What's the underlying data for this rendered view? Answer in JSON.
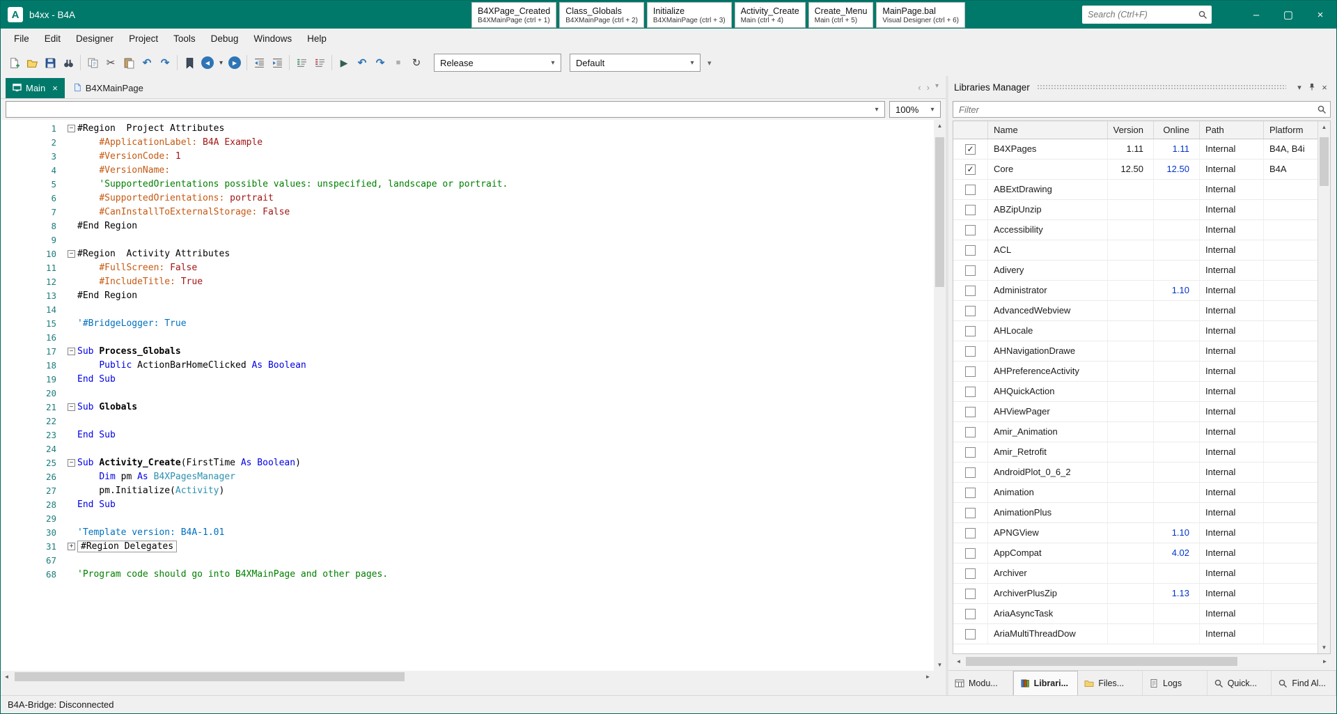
{
  "icons": {
    "minimize": "–",
    "maximize": "▢",
    "close": "×",
    "chevron_down": "▾",
    "tab_scroll_left": "‹",
    "tab_scroll_right": "›",
    "check": "✓",
    "fold_collapsed": "+",
    "fold_expanded": "−",
    "scroll_up": "▲",
    "scroll_down": "▼",
    "scroll_left": "◄",
    "scroll_right": "►",
    "cut": "✂",
    "undo": "↶",
    "redo": "↷",
    "back": "◀",
    "forward": "▶",
    "run": "▶",
    "step_into": "↶",
    "step_over": "↷",
    "stop": "■",
    "rebuild": "↻",
    "overflow": "▾"
  },
  "titlebar": {
    "logo_letter": "A",
    "app_title": "b4xx - B4A",
    "quick_tabs": [
      {
        "title": "B4XPage_Created",
        "subtitle": "B4XMainPage  (ctrl + 1)"
      },
      {
        "title": "Class_Globals",
        "subtitle": "B4XMainPage  (ctrl + 2)"
      },
      {
        "title": "Initialize",
        "subtitle": "B4XMainPage  (ctrl + 3)"
      },
      {
        "title": "Activity_Create",
        "subtitle": "Main  (ctrl + 4)"
      },
      {
        "title": "Create_Menu",
        "subtitle": "Main  (ctrl + 5)"
      },
      {
        "title": "MainPage.bal",
        "subtitle": "Visual Designer  (ctrl + 6)"
      }
    ],
    "search_placeholder": "Search (Ctrl+F)"
  },
  "menubar": {
    "items": [
      "File",
      "Edit",
      "Designer",
      "Project",
      "Tools",
      "Debug",
      "Windows",
      "Help"
    ]
  },
  "toolbar": {
    "build_config": "Release",
    "conditional_symbols": "Default"
  },
  "editor": {
    "tabs": [
      {
        "label": "Main",
        "active": true,
        "closable": true
      },
      {
        "label": "B4XMainPage",
        "active": false,
        "closable": false
      }
    ],
    "sub_navigator_value": "",
    "zoom": "100%",
    "lines": [
      {
        "n": "1",
        "fold": "-",
        "segs": [
          [
            "#Region  Project Attributes",
            "pl"
          ]
        ]
      },
      {
        "n": "2",
        "segs": [
          [
            "    ",
            "pl"
          ],
          [
            "#ApplicationLabel:",
            "at"
          ],
          [
            " ",
            "pl"
          ],
          [
            "B4A Example",
            "vl"
          ]
        ]
      },
      {
        "n": "3",
        "segs": [
          [
            "    ",
            "pl"
          ],
          [
            "#VersionCode:",
            "at"
          ],
          [
            " ",
            "pl"
          ],
          [
            "1",
            "vl"
          ]
        ]
      },
      {
        "n": "4",
        "segs": [
          [
            "    ",
            "pl"
          ],
          [
            "#VersionName:",
            "at"
          ]
        ]
      },
      {
        "n": "5",
        "segs": [
          [
            "    ",
            "pl"
          ],
          [
            "'SupportedOrientations possible values: unspecified, landscape or portrait.",
            "cm"
          ]
        ]
      },
      {
        "n": "6",
        "segs": [
          [
            "    ",
            "pl"
          ],
          [
            "#SupportedOrientations:",
            "at"
          ],
          [
            " ",
            "pl"
          ],
          [
            "portrait",
            "vl"
          ]
        ]
      },
      {
        "n": "7",
        "segs": [
          [
            "    ",
            "pl"
          ],
          [
            "#CanInstallToExternalStorage:",
            "at"
          ],
          [
            " ",
            "pl"
          ],
          [
            "False",
            "vl"
          ]
        ]
      },
      {
        "n": "8",
        "segs": [
          [
            "#End Region",
            "pl"
          ]
        ]
      },
      {
        "n": "9",
        "segs": []
      },
      {
        "n": "10",
        "fold": "-",
        "segs": [
          [
            "#Region  Activity Attributes",
            "pl"
          ]
        ]
      },
      {
        "n": "11",
        "segs": [
          [
            "    ",
            "pl"
          ],
          [
            "#FullScreen:",
            "at"
          ],
          [
            " ",
            "pl"
          ],
          [
            "False",
            "vl"
          ]
        ]
      },
      {
        "n": "12",
        "segs": [
          [
            "    ",
            "pl"
          ],
          [
            "#IncludeTitle:",
            "at"
          ],
          [
            " ",
            "pl"
          ],
          [
            "True",
            "vl"
          ]
        ]
      },
      {
        "n": "13",
        "segs": [
          [
            "#End Region",
            "pl"
          ]
        ]
      },
      {
        "n": "14",
        "segs": []
      },
      {
        "n": "15",
        "segs": [
          [
            "'#BridgeLogger: True",
            "dr"
          ]
        ]
      },
      {
        "n": "16",
        "segs": []
      },
      {
        "n": "17",
        "fold": "-",
        "segs": [
          [
            "Sub ",
            "kw"
          ],
          [
            "Process_Globals",
            "sb"
          ]
        ]
      },
      {
        "n": "18",
        "segs": [
          [
            "    ",
            "pl"
          ],
          [
            "Public ",
            "kw"
          ],
          [
            "ActionBarHomeClicked ",
            "pl"
          ],
          [
            "As ",
            "kw"
          ],
          [
            "Boolean",
            "kw"
          ]
        ]
      },
      {
        "n": "19",
        "segs": [
          [
            "End Sub",
            "kw"
          ]
        ]
      },
      {
        "n": "20",
        "segs": []
      },
      {
        "n": "21",
        "fold": "-",
        "segs": [
          [
            "Sub ",
            "kw"
          ],
          [
            "Globals",
            "sb"
          ]
        ]
      },
      {
        "n": "22",
        "segs": []
      },
      {
        "n": "23",
        "segs": [
          [
            "End Sub",
            "kw"
          ]
        ]
      },
      {
        "n": "24",
        "segs": []
      },
      {
        "n": "25",
        "fold": "-",
        "segs": [
          [
            "Sub ",
            "kw"
          ],
          [
            "Activity_Create",
            "sb"
          ],
          [
            "(FirstTime ",
            "pl"
          ],
          [
            "As ",
            "kw"
          ],
          [
            "Boolean",
            "kw"
          ],
          [
            ")",
            "pl"
          ]
        ]
      },
      {
        "n": "26",
        "segs": [
          [
            "    ",
            "pl"
          ],
          [
            "Dim ",
            "kw"
          ],
          [
            "pm ",
            "pl"
          ],
          [
            "As ",
            "kw"
          ],
          [
            "B4XPagesManager",
            "ty"
          ]
        ]
      },
      {
        "n": "27",
        "segs": [
          [
            "    pm.Initialize(",
            "pl"
          ],
          [
            "Activity",
            "ty"
          ],
          [
            ")",
            "pl"
          ]
        ]
      },
      {
        "n": "28",
        "segs": [
          [
            "End Sub",
            "kw"
          ]
        ]
      },
      {
        "n": "29",
        "segs": []
      },
      {
        "n": "30",
        "segs": [
          [
            "'Template version: B4A-1.01",
            "dr"
          ]
        ]
      },
      {
        "n": "31",
        "fold": "+",
        "collapsed": true,
        "segs": [
          [
            "#Region Delegates",
            "pl"
          ]
        ]
      },
      {
        "n": "67",
        "segs": []
      },
      {
        "n": "68",
        "segs": [
          [
            "'Program code should go into B4XMainPage and other pages.",
            "cm"
          ]
        ]
      }
    ]
  },
  "libraries": {
    "title": "Libraries Manager",
    "filter_placeholder": "Filter",
    "columns": [
      "Name",
      "Version",
      "Online",
      "Path",
      "Platform"
    ],
    "rows": [
      {
        "checked": true,
        "name": "B4XPages",
        "version": "1.11",
        "online": "1.11",
        "path": "Internal",
        "platform": "B4A, B4i"
      },
      {
        "checked": true,
        "name": "Core",
        "version": "12.50",
        "online": "12.50",
        "path": "Internal",
        "platform": "B4A"
      },
      {
        "checked": false,
        "name": "ABExtDrawing",
        "version": "",
        "online": "",
        "path": "Internal",
        "platform": ""
      },
      {
        "checked": false,
        "name": "ABZipUnzip",
        "version": "",
        "online": "",
        "path": "Internal",
        "platform": ""
      },
      {
        "checked": false,
        "name": "Accessibility",
        "version": "",
        "online": "",
        "path": "Internal",
        "platform": ""
      },
      {
        "checked": false,
        "name": "ACL",
        "version": "",
        "online": "",
        "path": "Internal",
        "platform": ""
      },
      {
        "checked": false,
        "name": "Adivery",
        "version": "",
        "online": "",
        "path": "Internal",
        "platform": ""
      },
      {
        "checked": false,
        "name": "Administrator",
        "version": "",
        "online": "1.10",
        "path": "Internal",
        "platform": ""
      },
      {
        "checked": false,
        "name": "AdvancedWebview",
        "version": "",
        "online": "",
        "path": "Internal",
        "platform": ""
      },
      {
        "checked": false,
        "name": "AHLocale",
        "version": "",
        "online": "",
        "path": "Internal",
        "platform": ""
      },
      {
        "checked": false,
        "name": "AHNavigationDrawe",
        "version": "",
        "online": "",
        "path": "Internal",
        "platform": ""
      },
      {
        "checked": false,
        "name": "AHPreferenceActivity",
        "version": "",
        "online": "",
        "path": "Internal",
        "platform": ""
      },
      {
        "checked": false,
        "name": "AHQuickAction",
        "version": "",
        "online": "",
        "path": "Internal",
        "platform": ""
      },
      {
        "checked": false,
        "name": "AHViewPager",
        "version": "",
        "online": "",
        "path": "Internal",
        "platform": ""
      },
      {
        "checked": false,
        "name": "Amir_Animation",
        "version": "",
        "online": "",
        "path": "Internal",
        "platform": ""
      },
      {
        "checked": false,
        "name": "Amir_Retrofit",
        "version": "",
        "online": "",
        "path": "Internal",
        "platform": ""
      },
      {
        "checked": false,
        "name": "AndroidPlot_0_6_2",
        "version": "",
        "online": "",
        "path": "Internal",
        "platform": ""
      },
      {
        "checked": false,
        "name": "Animation",
        "version": "",
        "online": "",
        "path": "Internal",
        "platform": ""
      },
      {
        "checked": false,
        "name": "AnimationPlus",
        "version": "",
        "online": "",
        "path": "Internal",
        "platform": ""
      },
      {
        "checked": false,
        "name": "APNGView",
        "version": "",
        "online": "1.10",
        "path": "Internal",
        "platform": ""
      },
      {
        "checked": false,
        "name": "AppCompat",
        "version": "",
        "online": "4.02",
        "path": "Internal",
        "platform": ""
      },
      {
        "checked": false,
        "name": "Archiver",
        "version": "",
        "online": "",
        "path": "Internal",
        "platform": ""
      },
      {
        "checked": false,
        "name": "ArchiverPlusZip",
        "version": "",
        "online": "1.13",
        "path": "Internal",
        "platform": ""
      },
      {
        "checked": false,
        "name": "AriaAsyncTask",
        "version": "",
        "online": "",
        "path": "Internal",
        "platform": ""
      },
      {
        "checked": false,
        "name": "AriaMultiThreadDow",
        "version": "",
        "online": "",
        "path": "Internal",
        "platform": ""
      }
    ],
    "bottom_tabs": [
      {
        "label": "Modu...",
        "icon": "modules",
        "active": false
      },
      {
        "label": "Librari...",
        "icon": "libraries",
        "active": true
      },
      {
        "label": "Files...",
        "icon": "files",
        "active": false
      },
      {
        "label": "Logs",
        "icon": "logs",
        "active": false
      },
      {
        "label": "Quick...",
        "icon": "search",
        "active": false
      },
      {
        "label": "Find Al...",
        "icon": "search",
        "active": false
      }
    ]
  },
  "statusbar": {
    "text": "B4A-Bridge: Disconnected"
  },
  "colors": {
    "accent_teal": "#00796B",
    "keyword_blue": "#0000E6",
    "type_teal": "#2B91AF",
    "comment_green": "#008000",
    "attribute_orange": "#C65911",
    "value_red": "#A31515",
    "online_link_blue": "#0033CC"
  }
}
